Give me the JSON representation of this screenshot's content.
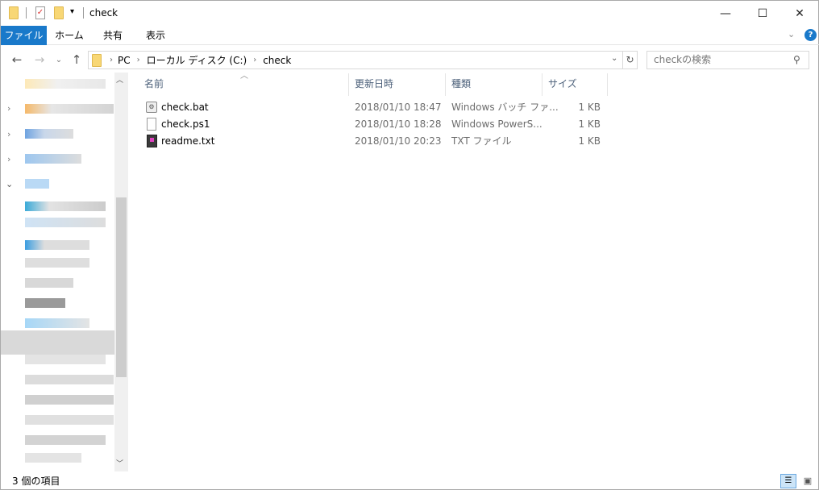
{
  "window": {
    "title": "check",
    "minimize": "—",
    "maximize": "☐",
    "close": "✕"
  },
  "ribbon": {
    "tabs": [
      "ファイル",
      "ホーム",
      "共有",
      "表示"
    ],
    "file_color": "#1979ca",
    "help": "?"
  },
  "address": {
    "segments": [
      "PC",
      "ローカル ディスク (C:)",
      "check"
    ]
  },
  "search": {
    "placeholder": "checkの検索"
  },
  "columns": [
    "名前",
    "更新日時",
    "種類",
    "サイズ"
  ],
  "files": [
    {
      "name": "check.bat",
      "modified": "2018/01/10 18:47",
      "type": "Windows バッチ ファ...",
      "size": "1 KB",
      "icon": "batch-file-icon"
    },
    {
      "name": "check.ps1",
      "modified": "2018/01/10 18:28",
      "type": "Windows PowerS...",
      "size": "1 KB",
      "icon": "document-icon"
    },
    {
      "name": "readme.txt",
      "modified": "2018/01/10 20:23",
      "type": "TXT ファイル",
      "size": "1 KB",
      "icon": "text-file-icon"
    }
  ],
  "status": {
    "item_count": "3 個の項目"
  }
}
